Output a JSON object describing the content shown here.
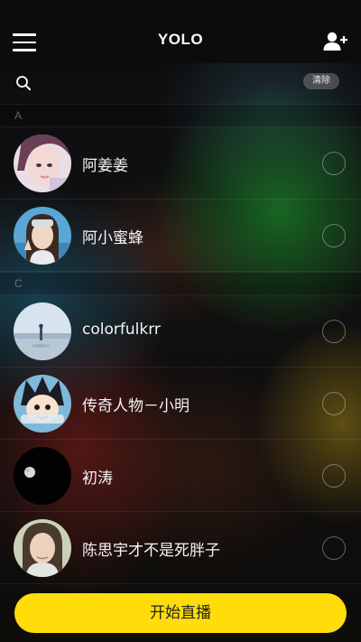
{
  "header": {
    "title": "YOLO",
    "menu_icon": "menu-icon",
    "add_user_icon": "add-user-icon"
  },
  "search": {
    "placeholder": "",
    "value": "",
    "clear_label": "清除"
  },
  "sections": [
    {
      "letter": "A",
      "contacts": [
        {
          "name": "阿姜姜",
          "selected": false
        },
        {
          "name": "阿小蜜蜂",
          "selected": false
        }
      ]
    },
    {
      "letter": "C",
      "contacts": [
        {
          "name": "colorfulkrr",
          "selected": false
        },
        {
          "name": "传奇人物－小明",
          "selected": false
        },
        {
          "name": "初涛",
          "selected": false
        },
        {
          "name": "陈思宇才不是死胖子",
          "selected": false
        }
      ]
    }
  ],
  "footer": {
    "start_label": "开始直播"
  },
  "colors": {
    "accent": "#ffdc0a",
    "header_bg": "#0c0c0e"
  }
}
